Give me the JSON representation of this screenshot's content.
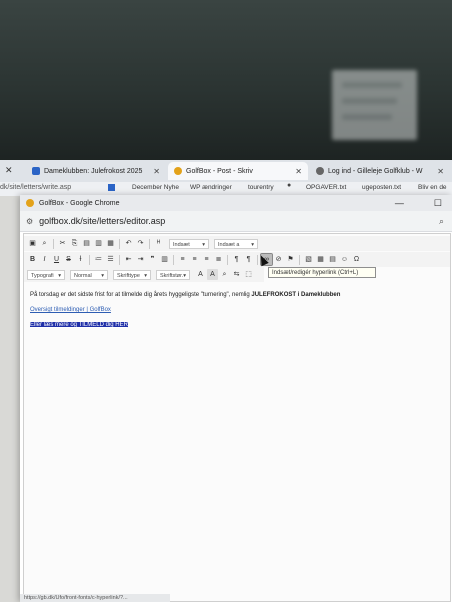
{
  "browser_tabs": [
    {
      "label": "Dameklubben: Julefrokost 2025",
      "active": false
    },
    {
      "label": "GolfBox - Post - Skriv",
      "active": true
    },
    {
      "label": "Log ind - Gilleleje Golfklub - W",
      "active": false
    }
  ],
  "background_window": {
    "url_fragment": "dk/site/letters/write.asp",
    "bookmarks": [
      "December Nyhe",
      "WP ændringer",
      "tourentry",
      "OPGAVER.txt",
      "ugeposten.txt",
      "Bliv en de"
    ]
  },
  "popup": {
    "title": "GolfBox - Google Chrome",
    "url": "golfbox.dk/site/letters/editor.asp"
  },
  "toolbar": {
    "row1_combos": [
      "Indsæt",
      "Indsæt a"
    ],
    "row3_combos": [
      "Typografi",
      "Normal",
      "Skrifttype",
      "Skriftstør."
    ],
    "tooltip": "Indsæt/redigér hyperlink (Ctrl+L)"
  },
  "content": {
    "line1_prefix": "På torsdag er det sidste frist for at tilmelde dig årets hyggeligste \"turnering\", nemlig ",
    "line1_bold": "JULEFROKOST i Dameklubben",
    "link1": "Oversigt tilmeldinger | GolfBox",
    "selected_link": "Eller læs mere og TILMELD dig HER"
  },
  "statusbar": "https://gb.dk/Ufo/front-fonts/c-hyperlink/?..."
}
